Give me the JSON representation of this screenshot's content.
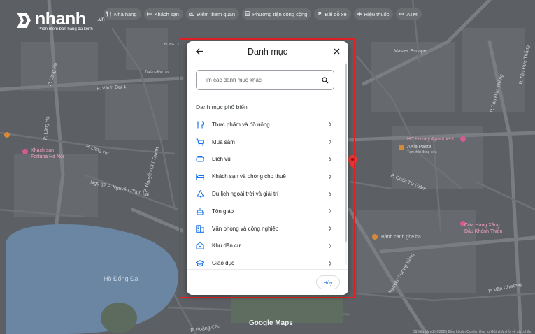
{
  "logo": {
    "brand": "nhanh",
    "tld": ".vn",
    "tagline": "Phần mềm bán hàng đa kênh"
  },
  "chips": [
    {
      "icon": "restaurant-icon",
      "label": "Nhà hàng"
    },
    {
      "icon": "hotel-icon",
      "label": "Khách sạn"
    },
    {
      "icon": "camera-icon",
      "label": "Điểm tham quan"
    },
    {
      "icon": "transit-icon",
      "label": "Phương tiện công cộng"
    },
    {
      "icon": "parking-icon",
      "label": "Bãi đỗ xe"
    },
    {
      "icon": "pharmacy-icon",
      "label": "Hiệu thuốc"
    },
    {
      "icon": "atm-icon",
      "label": "ATM"
    }
  ],
  "map": {
    "labels": {
      "vanh_dai_1": "P. Vành Đai 1",
      "lang_ha": "P. Láng Hạ",
      "lang_ha2": "P. Láng Hạ",
      "khach_san": "Khách sạn",
      "fortuna": "Fortuna Hà Nội",
      "chung_cu": "CHUNG CƯ",
      "truong": "Trường Đại học",
      "nguyen_chi_thanh": "P. Nguyễn Chí Thanh",
      "ngo_82": "Ngõ 82 P. Nguyễn Phúc Lai",
      "lang_ha3": "P. Láng Hạ",
      "ho_dong_da": "Hồ Đống Đa",
      "google": "Google Maps",
      "hoang_cau": "P. Hoàng Cầu",
      "master_escape": "Master Escape",
      "hc_luxury": "HC Luxury Apartment",
      "axie": "AXie Pasta",
      "axie_sub": "Tạm thời đóng cửa",
      "ton_duc_thang": "P. Tôn Đức Thắng",
      "ton_duc_thang2": "P. Tôn Đức Thắng",
      "quoc_tu_giam": "P. Quốc Tử Giám",
      "banh_canh": "Bánh canh ghẹ ba",
      "cua_hang": "Cửa Hàng Xăng",
      "dau_khanh": "Dầu Khánh Thiện",
      "nguyen_luong_bang": "Nguyễn Lương Bằng",
      "van_chuong": "P. Văn Chương",
      "footer": "Dữ liệu bản đồ ©2025  Điều khoản  Quyền riêng tư  Gửi phản hồi về sản phẩm"
    }
  },
  "dialog": {
    "title": "Danh mục",
    "search_placeholder": "Tìm các danh mục khác",
    "section_title": "Danh mục phổ biến",
    "categories": [
      {
        "icon": "food-icon",
        "label": "Thực phẩm và đồ uống"
      },
      {
        "icon": "shopping-cart-icon",
        "label": "Mua sắm"
      },
      {
        "icon": "services-icon",
        "label": "Dịch vụ"
      },
      {
        "icon": "hotel-bed-icon",
        "label": "Khách sạn và phòng cho thuê"
      },
      {
        "icon": "outdoor-icon",
        "label": "Du lịch ngoài trời và giải trí"
      },
      {
        "icon": "religion-icon",
        "label": "Tôn giáo"
      },
      {
        "icon": "office-building-icon",
        "label": "Văn phòng và công nghiệp"
      },
      {
        "icon": "home-icon",
        "label": "Khu dân cư"
      },
      {
        "icon": "school-icon",
        "label": "Giáo dục"
      }
    ],
    "cancel_label": "Hủy"
  },
  "colors": {
    "accent": "#1a73e8",
    "highlight": "#e21f26",
    "icon_blue": "#1a73e8"
  }
}
